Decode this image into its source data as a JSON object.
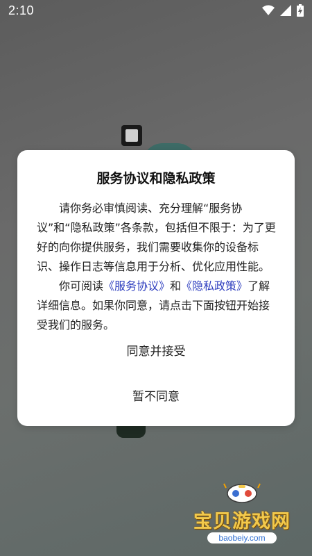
{
  "status_bar": {
    "time": "2:10"
  },
  "dialog": {
    "title": "服务协议和隐私政策",
    "paragraph1": "请你务必审慎阅读、充分理解“服务协议”和“隐私政策”各条款，包括但不限于：为了更好的向你提供服务，我们需要收集你的设备标识、操作日志等信息用于分析、优化应用性能。",
    "paragraph2_prefix": "你可阅读",
    "service_link": "《服务协议》",
    "paragraph2_and": "和",
    "privacy_link": "《隐私政策》",
    "paragraph2_suffix": "了解详细信息。如果你同意，请点击下面按钮开始接受我们的服务。",
    "agree_button": "同意并接受",
    "disagree_button": "暂不同意",
    "link_color": "#2f3fbf"
  },
  "watermark": {
    "title": "宝贝游戏网",
    "url": "baobeiy.com"
  },
  "icons": {
    "wifi": "wifi-icon",
    "signal": "signal-icon",
    "battery": "battery-icon"
  }
}
